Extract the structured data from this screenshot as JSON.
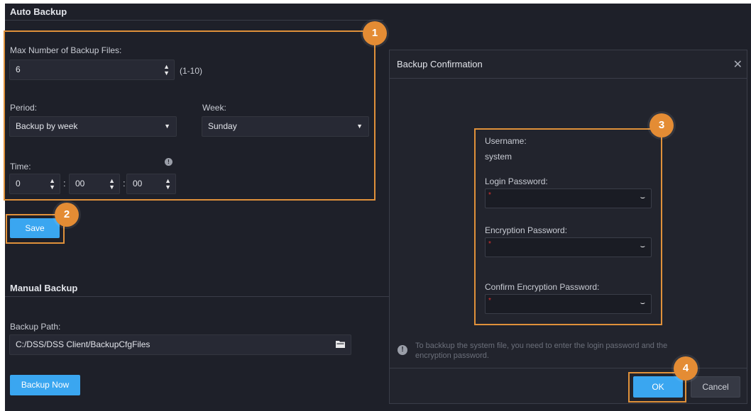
{
  "auto_backup": {
    "title": "Auto Backup",
    "max_files_label": "Max Number of Backup Files:",
    "max_files_value": "6",
    "max_files_range": "(1-10)",
    "period_label": "Period:",
    "period_value": "Backup by week",
    "week_label": "Week:",
    "week_value": "Sunday",
    "time_label": "Time:",
    "time_hour": "0",
    "time_minute": "00",
    "time_second": "00",
    "time_sep": ":",
    "save_label": "Save"
  },
  "manual_backup": {
    "title": "Manual Backup",
    "path_label": "Backup Path:",
    "path_value": "C:/DSS/DSS Client/BackupCfgFiles",
    "backup_now_label": "Backup Now"
  },
  "dialog": {
    "title": "Backup Confirmation",
    "close_glyph": "✕",
    "username_label": "Username:",
    "username_value": "system",
    "login_pw_label": "Login Password:",
    "enc_pw_label": "Encryption Password:",
    "confirm_enc_pw_label": "Confirm Encryption Password:",
    "required_mark": "*",
    "note_line1": "To backkup the system file, you need to enter the login password and the",
    "note_line2": "encryption password.",
    "ok_label": "OK",
    "cancel_label": "Cancel"
  },
  "callouts": [
    "1",
    "2",
    "3",
    "4"
  ],
  "colors": {
    "background": "#1e2029",
    "accent_blue": "#3aa6f0",
    "callout_orange": "#e48c34"
  },
  "icons": {
    "spinner": "spinner-arrows-icon",
    "dropdown": "caret-down-icon",
    "eye": "eye-closed-icon",
    "folder": "folder-icon",
    "info": "info-icon",
    "close": "close-icon"
  }
}
